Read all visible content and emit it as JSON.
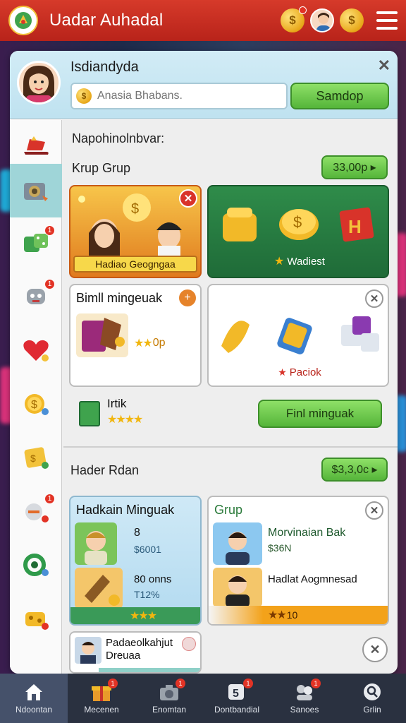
{
  "app": {
    "title": "Uadar Auhadal",
    "accent": "#c7281d"
  },
  "topbar": {
    "coin_icon": "coin-icon",
    "menu_icon": "hamburger-menu-icon"
  },
  "profile": {
    "name": "Isdiandyda",
    "search_placeholder": "Anasia Bhabans.",
    "search_button": "Samdop"
  },
  "sidebar": {
    "items": [
      {
        "icon": "sleigh-icon"
      },
      {
        "icon": "camera-icon"
      },
      {
        "icon": "dice-icon",
        "badge": "1"
      },
      {
        "icon": "robot-icon",
        "badge": "1"
      },
      {
        "icon": "heart-icon"
      },
      {
        "icon": "coin-icon"
      },
      {
        "icon": "ticket-icon"
      },
      {
        "icon": "gift-icon",
        "badge": "1"
      },
      {
        "icon": "ring-icon"
      },
      {
        "icon": "treasure-icon"
      }
    ]
  },
  "section1": {
    "heading": "Napohinolnbvar:",
    "group_label": "Krup Grup",
    "price_button": "33,00p ▸",
    "card_promo_label": "Hadiao Geogngaa",
    "card_green_label": "Wadiest",
    "card_item_title": "Bimll mingeuak",
    "card_item_rating": "0p",
    "card_item_badge": "+",
    "card_packs_label": "Paciok",
    "filter_label": "Irtik",
    "find_button": "Finl minguak"
  },
  "section2": {
    "heading": "Hader Rdan",
    "price_button": "$3,3,0c ▸",
    "card_left_title": "Hadkain Minguak",
    "card_left_rows": [
      {
        "value": "8",
        "sub": "$6001"
      },
      {
        "value": "80 onns",
        "sub": "T12%"
      }
    ],
    "card_right_title": "Grup",
    "card_right_rows": [
      {
        "value": "Morvinaian Bak",
        "sub": "$36N"
      },
      {
        "value": "Hadlat Aogmnesad",
        "sub": ""
      }
    ],
    "card_right_rating": "10",
    "card_bottom_title": "Padaeolkahjut",
    "card_bottom_sub": "Dreuaa"
  },
  "bottom_nav": [
    {
      "label": "Ndoontan",
      "icon": "home-icon",
      "active": true
    },
    {
      "label": "Mecenen",
      "icon": "gift-icon",
      "badge": "1"
    },
    {
      "label": "Enomtan",
      "icon": "camera-icon",
      "badge": "1"
    },
    {
      "label": "Dontbandial",
      "icon": "dice-icon",
      "badge": "1"
    },
    {
      "label": "Sanoes",
      "icon": "group-icon",
      "badge": "1"
    },
    {
      "label": "Grlin",
      "icon": "search-icon"
    }
  ]
}
